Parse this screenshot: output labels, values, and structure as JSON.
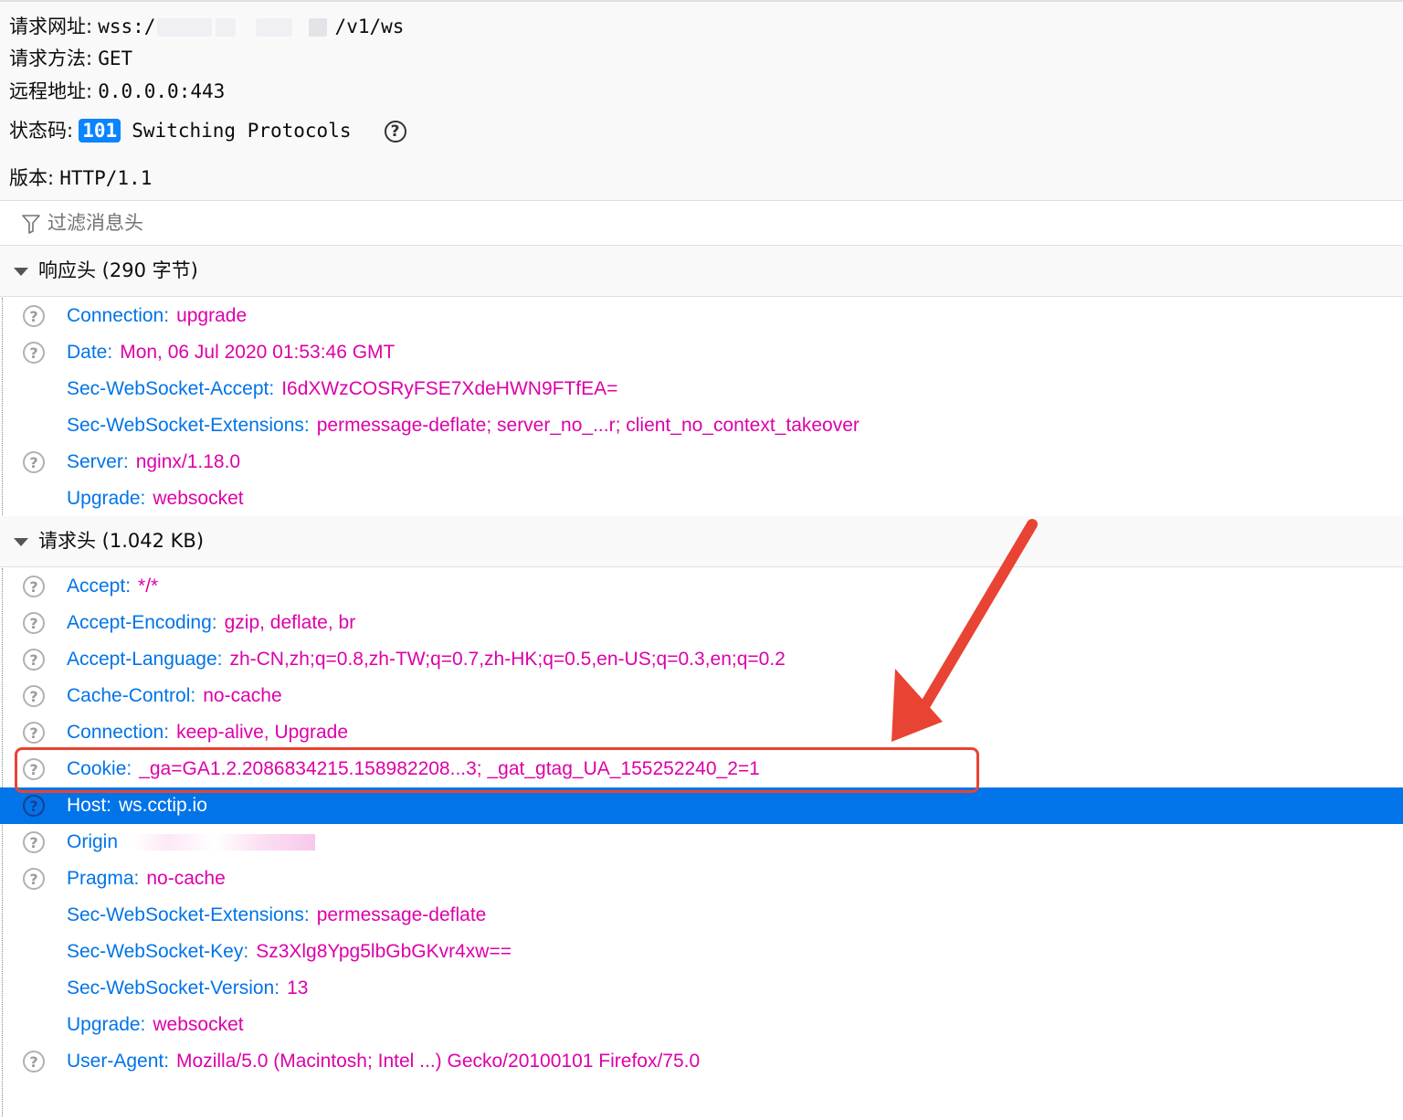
{
  "summary": {
    "url_label": "请求网址:",
    "url_prefix": "wss:/",
    "url_suffix": "/v1/ws",
    "method_label": "请求方法:",
    "method_value": "GET",
    "remote_label": "远程地址:",
    "remote_value": "0.0.0.0:443",
    "status_label": "状态码:",
    "status_code": "101",
    "status_text": "Switching Protocols",
    "version_label": "版本:",
    "version_value": "HTTP/1.1"
  },
  "filter": {
    "placeholder": "过滤消息头"
  },
  "response": {
    "title": "响应头 (290 字节)",
    "headers": [
      {
        "name": "Connection:",
        "value": "upgrade",
        "help": true
      },
      {
        "name": "Date:",
        "value": "Mon, 06 Jul 2020 01:53:46 GMT",
        "help": true
      },
      {
        "name": "Sec-WebSocket-Accept:",
        "value": "I6dXWzCOSRyFSE7XdeHWN9FTfEA=",
        "help": false
      },
      {
        "name": "Sec-WebSocket-Extensions:",
        "value": "permessage-deflate; server_no_...r; client_no_context_takeover",
        "help": false
      },
      {
        "name": "Server:",
        "value": "nginx/1.18.0",
        "help": true
      },
      {
        "name": "Upgrade:",
        "value": "websocket",
        "help": false
      }
    ]
  },
  "request": {
    "title": "请求头 (1.042 KB)",
    "headers": [
      {
        "name": "Accept:",
        "value": "*/*",
        "help": true
      },
      {
        "name": "Accept-Encoding:",
        "value": "gzip, deflate, br",
        "help": true
      },
      {
        "name": "Accept-Language:",
        "value": "zh-CN,zh;q=0.8,zh-TW;q=0.7,zh-HK;q=0.5,en-US;q=0.3,en;q=0.2",
        "help": true
      },
      {
        "name": "Cache-Control:",
        "value": "no-cache",
        "help": true
      },
      {
        "name": "Connection:",
        "value": "keep-alive, Upgrade",
        "help": true
      },
      {
        "name": "Cookie:",
        "value": "_ga=GA1.2.2086834215.158982208...3; _gat_gtag_UA_155252240_2=1",
        "help": true
      },
      {
        "name": "Host:",
        "value": "ws.cctip.io",
        "help": true
      },
      {
        "name": "Origin",
        "value": "",
        "help": true
      },
      {
        "name": "Pragma:",
        "value": "no-cache",
        "help": true
      },
      {
        "name": "Sec-WebSocket-Extensions:",
        "value": "permessage-deflate",
        "help": false
      },
      {
        "name": "Sec-WebSocket-Key:",
        "value": "Sz3Xlg8Ypg5lbGbGKvr4xw==",
        "help": false
      },
      {
        "name": "Sec-WebSocket-Version:",
        "value": "13",
        "help": false
      },
      {
        "name": "Upgrade:",
        "value": "websocket",
        "help": false
      },
      {
        "name": "User-Agent:",
        "value": "Mozilla/5.0 (Macintosh; Intel ...) Gecko/20100101 Firefox/75.0",
        "help": true
      }
    ]
  },
  "icons": {
    "help": "question-circle-icon",
    "filter": "filter-icon",
    "expand": "triangle-down-icon"
  },
  "colors": {
    "header_name": "#0074e8",
    "header_value": "#dd00a9",
    "selected_row": "#0074e8",
    "annotation": "#e94333"
  }
}
